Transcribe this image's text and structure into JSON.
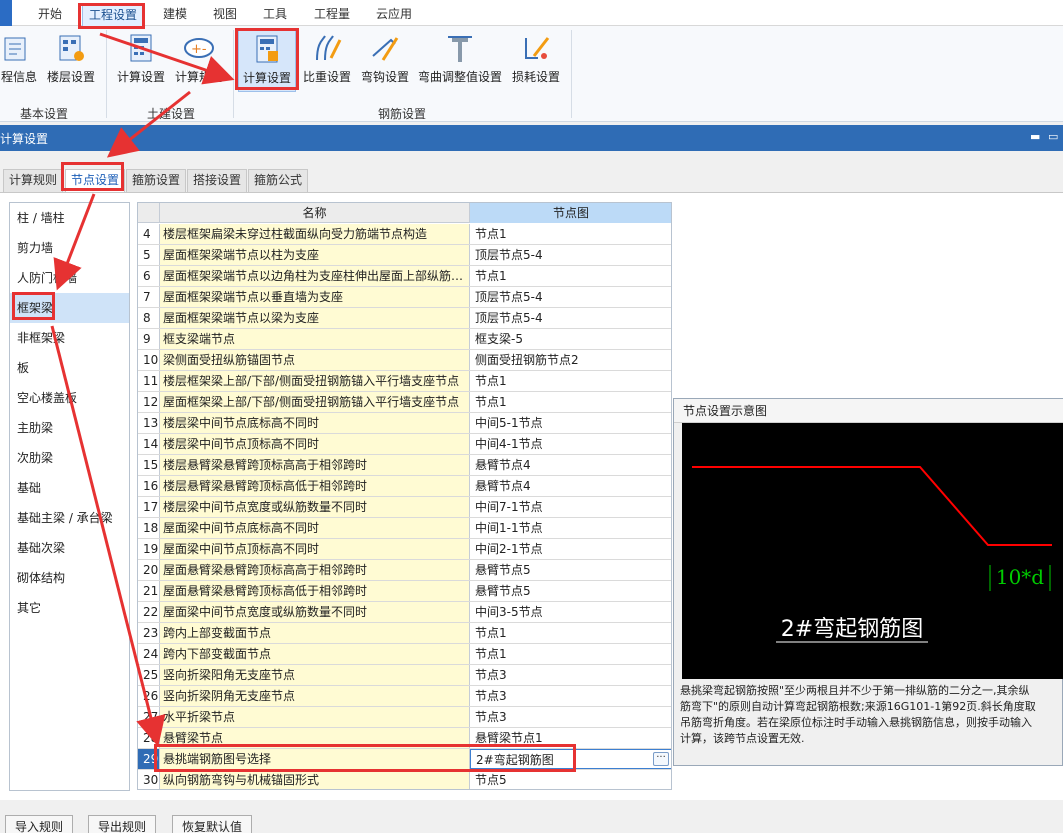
{
  "menu": {
    "tabs": [
      "开始",
      "工程设置",
      "建模",
      "视图",
      "工具",
      "工程量",
      "云应用"
    ],
    "active": "工程设置"
  },
  "ribbon": {
    "buttons": {
      "project_info": "程信息",
      "floor_settings": "楼层设置",
      "civil_calc_settings": "计算设置",
      "civil_calc_rules": "计算规则",
      "rebar_calc_settings": "计算设置",
      "weight_settings": "比重设置",
      "hook_settings": "弯钩设置",
      "bend_adjust_settings": "弯曲调整值设置",
      "loss_settings": "损耗设置"
    },
    "groups": {
      "basic": "基本设置",
      "civil": "土建设置",
      "rebar": "钢筋设置"
    }
  },
  "panel": {
    "title": "计算设置",
    "controls": {
      "minimize": "▬",
      "restore": "▭"
    }
  },
  "sub_tabs": {
    "calc_rules": "计算规则",
    "node_settings": "节点设置",
    "stirrup_settings": "箍筋设置",
    "lap_settings": "搭接设置",
    "stirrup_formula": "箍筋公式"
  },
  "left_nav": {
    "items": [
      "柱 / 墙柱",
      "剪力墙",
      "人防门框墙",
      "框架梁",
      "非框架梁",
      "板",
      "空心楼盖板",
      "主肋梁",
      "次肋梁",
      "基础",
      "基础主梁 / 承台梁",
      "基础次梁",
      "砌体结构",
      "其它"
    ],
    "selected": "框架梁"
  },
  "grid": {
    "headers": {
      "name": "名称",
      "diagram": "节点图"
    },
    "rows": [
      {
        "no": "4",
        "name": "楼层框架扁梁未穿过柱截面纵向受力筋端节点构造",
        "value": "节点1"
      },
      {
        "no": "5",
        "name": "屋面框架梁端节点以柱为支座",
        "value": "顶层节点5-4"
      },
      {
        "no": "6",
        "name": "屋面框架梁端节点以边角柱为支座柱伸出屋面上部纵筋…",
        "value": "节点1"
      },
      {
        "no": "7",
        "name": "屋面框架梁端节点以垂直墙为支座",
        "value": "顶层节点5-4"
      },
      {
        "no": "8",
        "name": "屋面框架梁端节点以梁为支座",
        "value": "顶层节点5-4"
      },
      {
        "no": "9",
        "name": "框支梁端节点",
        "value": "框支梁-5"
      },
      {
        "no": "10",
        "name": "梁侧面受扭纵筋锚固节点",
        "value": "侧面受扭钢筋节点2"
      },
      {
        "no": "11",
        "name": "楼层框架梁上部/下部/侧面受扭钢筋锚入平行墙支座节点",
        "value": "节点1"
      },
      {
        "no": "12",
        "name": "屋面框架梁上部/下部/侧面受扭钢筋锚入平行墙支座节点",
        "value": "节点1"
      },
      {
        "no": "13",
        "name": "楼层梁中间节点底标高不同时",
        "value": "中间5-1节点"
      },
      {
        "no": "14",
        "name": "楼层梁中间节点顶标高不同时",
        "value": "中间4-1节点"
      },
      {
        "no": "15",
        "name": "楼层悬臂梁悬臂跨顶标高高于相邻跨时",
        "value": "悬臂节点4"
      },
      {
        "no": "16",
        "name": "楼层悬臂梁悬臂跨顶标高低于相邻跨时",
        "value": "悬臂节点4"
      },
      {
        "no": "17",
        "name": "楼层梁中间节点宽度或纵筋数量不同时",
        "value": "中间7-1节点"
      },
      {
        "no": "18",
        "name": "屋面梁中间节点底标高不同时",
        "value": "中间1-1节点"
      },
      {
        "no": "19",
        "name": "屋面梁中间节点顶标高不同时",
        "value": "中间2-1节点"
      },
      {
        "no": "20",
        "name": "屋面悬臂梁悬臂跨顶标高高于相邻跨时",
        "value": "悬臂节点5"
      },
      {
        "no": "21",
        "name": "屋面悬臂梁悬臂跨顶标高低于相邻跨时",
        "value": "悬臂节点5"
      },
      {
        "no": "22",
        "name": "屋面梁中间节点宽度或纵筋数量不同时",
        "value": "中间3-5节点"
      },
      {
        "no": "23",
        "name": "跨内上部变截面节点",
        "value": "节点1"
      },
      {
        "no": "24",
        "name": "跨内下部变截面节点",
        "value": "节点1"
      },
      {
        "no": "25",
        "name": "竖向折梁阳角无支座节点",
        "value": "节点3"
      },
      {
        "no": "26",
        "name": "竖向折梁阴角无支座节点",
        "value": "节点3"
      },
      {
        "no": "27",
        "name": "水平折梁节点",
        "value": "节点3"
      },
      {
        "no": "28",
        "name": "悬臂梁节点",
        "value": "悬臂梁节点1"
      },
      {
        "no": "29",
        "name": "悬挑端钢筋图号选择",
        "value": "2#弯起钢筋图",
        "selected": true
      },
      {
        "no": "30",
        "name": "纵向钢筋弯钩与机械锚固形式",
        "value": "节点5"
      }
    ],
    "ellipsis": "···"
  },
  "preview": {
    "title": "节点设置示意图",
    "dimension_label": "10*d",
    "caption": "2#弯起钢筋图",
    "description": [
      "悬挑梁弯起钢筋按照\"至少两根且并不少于第一排纵筋的二分之一,其余纵",
      "筋弯下\"的原则自动计算弯起钢筋根数;来源16G101-1第92页.斜长角度取",
      "吊筋弯折角度。若在梁原位标注时手动输入悬挑钢筋信息，则按手动输入",
      "计算，该跨节点设置无效."
    ]
  },
  "bottom": {
    "import_rules": "导入规则",
    "export_rules": "导出规则",
    "restore_default": "恢复默认值"
  },
  "colors": {
    "titlebar": "#2f6cb5",
    "annotation": "#e63232",
    "name_cell": "#fffbd3",
    "diagram_line": "#ff0000",
    "diagram_dim": "#00cc00"
  }
}
